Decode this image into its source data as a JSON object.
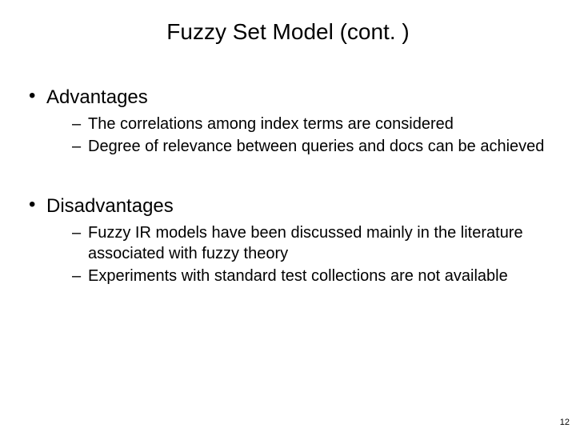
{
  "title": "Fuzzy Set Model (cont. )",
  "sections": [
    {
      "heading": "Advantages",
      "items": [
        "The correlations among index terms are considered",
        "Degree of relevance between queries and docs can be achieved"
      ]
    },
    {
      "heading": "Disadvantages",
      "items": [
        "Fuzzy IR models have been discussed mainly in the literature associated with fuzzy theory",
        "Experiments with standard test collections are not available"
      ]
    }
  ],
  "page_number": "12"
}
